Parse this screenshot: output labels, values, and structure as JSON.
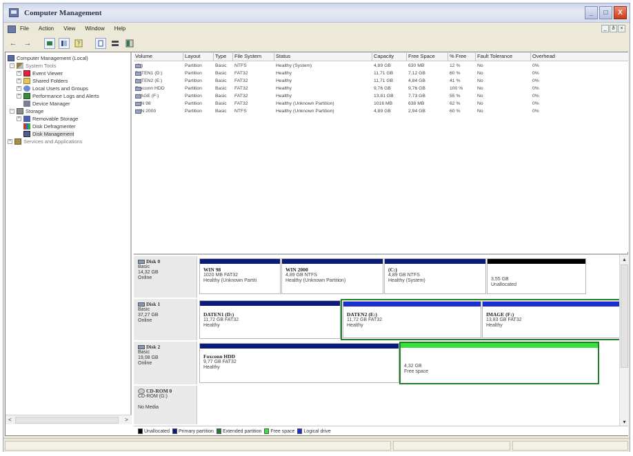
{
  "window": {
    "title": "Computer Management",
    "buttons": {
      "minimize": "_",
      "maximize": "□",
      "close": "X"
    },
    "mdi_buttons": [
      "_",
      "ð",
      "×"
    ]
  },
  "menu": {
    "items": [
      "File",
      "Action",
      "View",
      "Window",
      "Help"
    ]
  },
  "toolbar": {
    "back": "←",
    "forward": "→"
  },
  "tree": {
    "items": [
      {
        "label": "Computer Management (Local)",
        "level": 0,
        "icon": "computer-icon",
        "expander": ""
      },
      {
        "label": "System Tools",
        "level": 1,
        "icon": "tools-icon",
        "expander": "-"
      },
      {
        "label": "Event Viewer",
        "level": 2,
        "icon": "event-viewer-icon",
        "expander": "+"
      },
      {
        "label": "Shared Folders",
        "level": 2,
        "icon": "folder-icon",
        "expander": "+"
      },
      {
        "label": "Local Users and Groups",
        "level": 2,
        "icon": "users-icon",
        "expander": "+"
      },
      {
        "label": "Performance Logs and Alerts",
        "level": 2,
        "icon": "performance-icon",
        "expander": "+"
      },
      {
        "label": "Device Manager",
        "level": 2,
        "icon": "device-manager-icon",
        "expander": ""
      },
      {
        "label": "Storage",
        "level": 1,
        "icon": "storage-icon",
        "expander": "-"
      },
      {
        "label": "Removable Storage",
        "level": 2,
        "icon": "removable-storage-icon",
        "expander": "+"
      },
      {
        "label": "Disk Defragmenter",
        "level": 2,
        "icon": "defragmenter-icon",
        "expander": ""
      },
      {
        "label": "Disk Management",
        "level": 2,
        "icon": "disk-management-icon",
        "expander": "",
        "selected": true
      },
      {
        "label": "Services and Applications",
        "level": 1,
        "icon": "services-icon",
        "expander": "+"
      }
    ],
    "scroll_left": "<",
    "scroll_right": ">"
  },
  "volume_list": {
    "columns": [
      "Volume",
      "Layout",
      "Type",
      "File System",
      "Status",
      "Capacity",
      "Free Space",
      "% Free",
      "Fault Tolerance",
      "Overhead"
    ],
    "rows": [
      [
        "(C:)",
        "Partition",
        "Basic",
        "NTFS",
        "Healthy (System)",
        "4,89 GB",
        "630 MB",
        "12 %",
        "No",
        "0%"
      ],
      [
        "DATEN1 (D:)",
        "Partition",
        "Basic",
        "FAT32",
        "Healthy",
        "11,71 GB",
        "7,12 GB",
        "60 %",
        "No",
        "0%"
      ],
      [
        "DATEN2 (E:)",
        "Partition",
        "Basic",
        "FAT32",
        "Healthy",
        "11,71 GB",
        "4,84 GB",
        "41 %",
        "No",
        "0%"
      ],
      [
        "Foxconn HDD",
        "Partition",
        "Basic",
        "FAT32",
        "Healthy",
        "9,76 GB",
        "9,76 GB",
        "100 %",
        "No",
        "0%"
      ],
      [
        "IMAGE (F:)",
        "Partition",
        "Basic",
        "FAT32",
        "Healthy",
        "13,81 GB",
        "7,73 GB",
        "55 %",
        "No",
        "0%"
      ],
      [
        "WIN 98",
        "Partition",
        "Basic",
        "FAT32",
        "Healthy (Unknown Partition)",
        "1016 MB",
        "638 MB",
        "62 %",
        "No",
        "0%"
      ],
      [
        "WIN 2000",
        "Partition",
        "Basic",
        "NTFS",
        "Healthy (Unknown Partition)",
        "4,89 GB",
        "2,94 GB",
        "60 %",
        "No",
        "0%"
      ]
    ]
  },
  "disks": [
    {
      "name": "Disk 0",
      "type": "Basic",
      "size": "14,32 GB",
      "status": "Online",
      "partitions": [
        {
          "name": "WIN 98",
          "line1": "1020 MB FAT32",
          "line2": "Healthy (Unknown Partiti",
          "kind": "primary"
        },
        {
          "name": "WIN 2000",
          "line1": "4,89 GB NTFS",
          "line2": "Healthy (Unknown Partition)",
          "kind": "primary"
        },
        {
          "name": "(C:)",
          "line1": "4,89 GB NTFS",
          "line2": "Healthy (System)",
          "kind": "primary"
        },
        {
          "name": "",
          "line1": "3,55 GB",
          "line2": "Unallocated",
          "kind": "unallocated"
        }
      ]
    },
    {
      "name": "Disk 1",
      "type": "Basic",
      "size": "37,27 GB",
      "status": "Online",
      "partitions": [
        {
          "name": "DATEN1  (D:)",
          "line1": "11,72 GB FAT32",
          "line2": "Healthy",
          "kind": "primary"
        },
        {
          "name": "DATEN2 (E:)",
          "line1": "11,72 GB FAT32",
          "line2": "Healthy",
          "kind": "logical"
        },
        {
          "name": "IMAGE  (F:)",
          "line1": "13,83 GB FAT32",
          "line2": "Healthy",
          "kind": "logical"
        }
      ]
    },
    {
      "name": "Disk 2",
      "type": "Basic",
      "size": "19,08 GB",
      "status": "Online",
      "partitions": [
        {
          "name": "Foxconn HDD",
          "line1": "9,77 GB FAT32",
          "line2": "Healthy",
          "kind": "primary"
        },
        {
          "name": "",
          "line1": "4,32 GB",
          "line2": "Free space",
          "kind": "free"
        }
      ]
    },
    {
      "name": "CD-ROM 0",
      "type": "CD-ROM (G:)",
      "size": "",
      "status": "No Media",
      "partitions": []
    }
  ],
  "legend": [
    {
      "label": "Unallocated",
      "color": "#000000"
    },
    {
      "label": "Primary partition",
      "color": "#0a1a78"
    },
    {
      "label": "Extended partition",
      "color": "#1d7e2b"
    },
    {
      "label": "Free space",
      "color": "#39e03c"
    },
    {
      "label": "Logical drive",
      "color": "#1a2fd0"
    }
  ]
}
